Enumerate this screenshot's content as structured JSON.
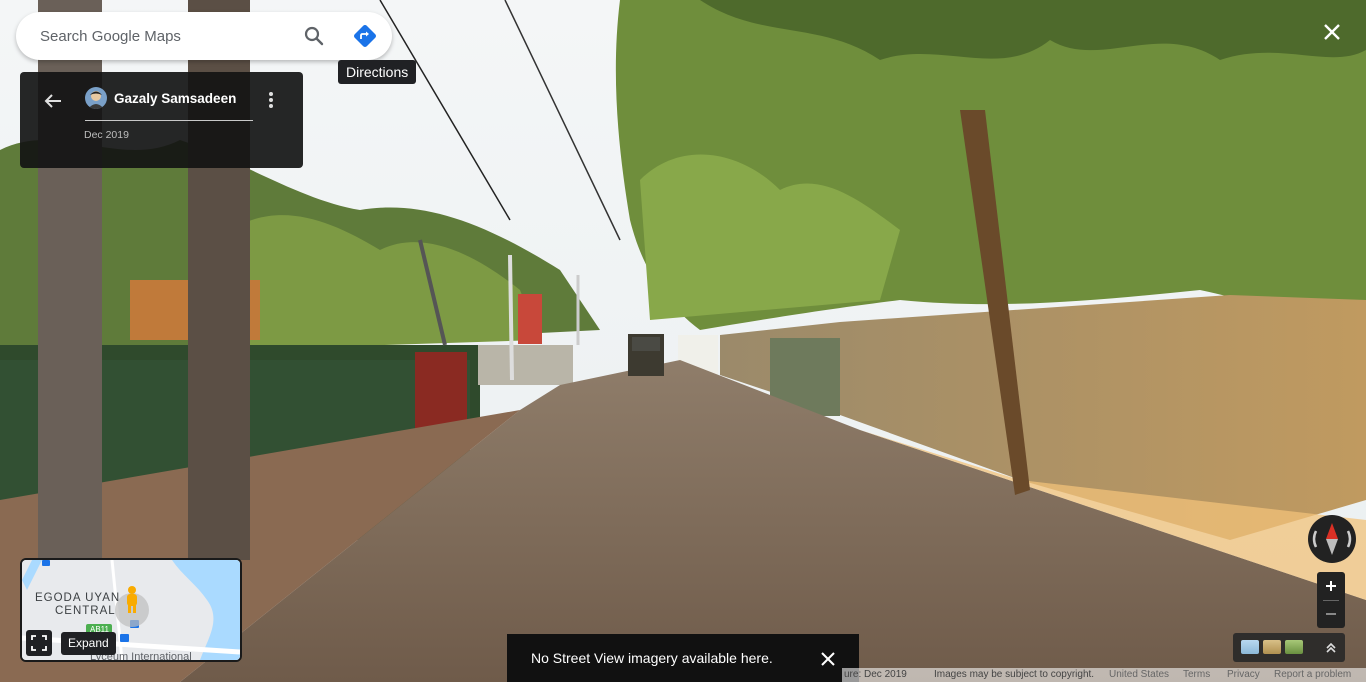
{
  "search": {
    "placeholder": "Search Google Maps"
  },
  "tooltip": {
    "directions": "Directions"
  },
  "photo_card": {
    "author": "Gazaly Samsadeen",
    "date": "Dec 2019"
  },
  "minimap": {
    "labels": [
      "EGODA UYAN",
      "CENTRAL",
      "AB11",
      "Lyceum International"
    ],
    "expand_tooltip": "Expand"
  },
  "toast": {
    "message": "No Street View imagery available here."
  },
  "footer": {
    "capture": "ure: Dec 2019",
    "copyright": "Images may be subject to copyright.",
    "country": "United States",
    "terms": "Terms",
    "privacy": "Privacy",
    "report": "Report a problem"
  },
  "icons": {
    "search": "search-icon",
    "directions": "directions-icon",
    "back": "arrow-left-icon",
    "more": "more-vert-icon",
    "close": "close-icon",
    "compass": "compass-icon",
    "zoom_in": "plus-icon",
    "zoom_out": "minus-icon",
    "expand": "fullscreen-icon",
    "layers_expand": "chevron-up-double-icon",
    "pegman": "pegman-icon"
  },
  "colors": {
    "accent": "#1a73e8",
    "compass_red": "#d93025",
    "water": "#aadaff"
  }
}
